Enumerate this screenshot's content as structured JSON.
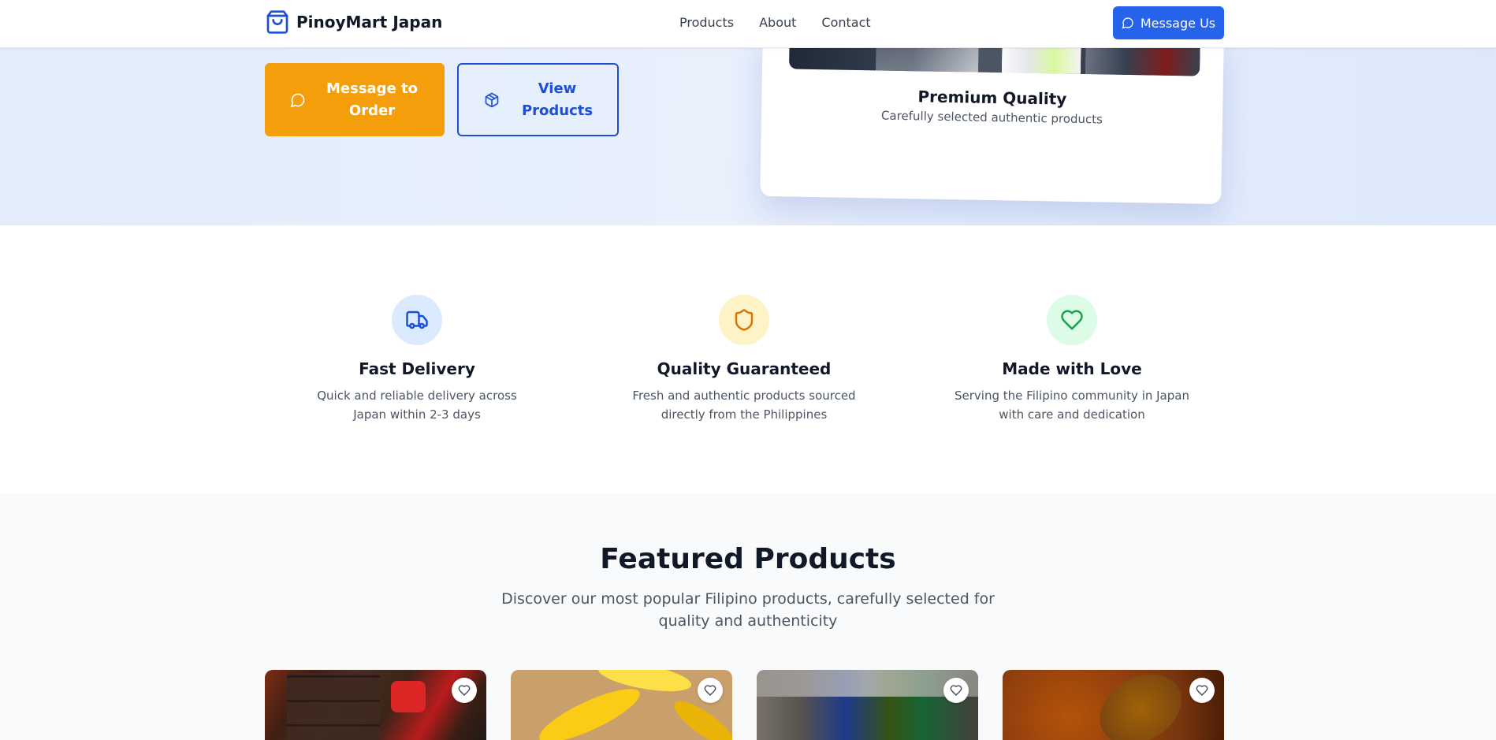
{
  "nav": {
    "brand": "PinoyMart Japan",
    "links": [
      "Products",
      "About",
      "Contact"
    ],
    "cta": "Message Us"
  },
  "hero": {
    "order_button": "Message to Order",
    "products_button": "View Products",
    "card_title": "Premium Quality",
    "card_subtitle": "Carefully selected authentic products"
  },
  "features": [
    {
      "title": "Fast Delivery",
      "desc": "Quick and reliable delivery across Japan within 2-3 days",
      "icon": "truck-icon",
      "color": "#1d4ed8",
      "bg": "#dbeafe"
    },
    {
      "title": "Quality Guaranteed",
      "desc": "Fresh and authentic products sourced directly from the Philippines",
      "icon": "shield-icon",
      "color": "#d97706",
      "bg": "#fef3c7"
    },
    {
      "title": "Made with Love",
      "desc": "Serving the Filipino community in Japan with care and dedication",
      "icon": "heart-icon",
      "color": "#16a34a",
      "bg": "#dcfce7"
    }
  ],
  "featured": {
    "title": "Featured Products",
    "subtitle": "Discover our most popular Filipino products, carefully selected for quality and authenticity"
  },
  "colors": {
    "primary": "#2563eb",
    "accent": "#f59e0b"
  }
}
